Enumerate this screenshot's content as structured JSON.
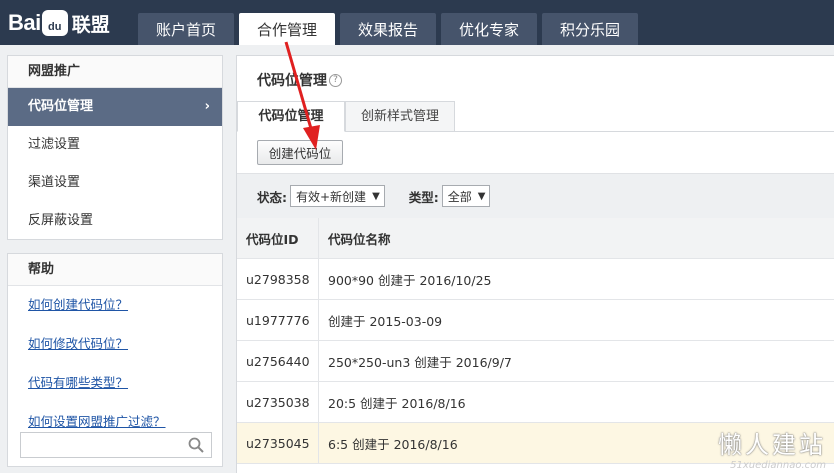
{
  "logo": {
    "bai": "Bai",
    "du": "du",
    "union": "联盟"
  },
  "nav": {
    "tabs": [
      {
        "label": "账户首页"
      },
      {
        "label": "合作管理"
      },
      {
        "label": "效果报告"
      },
      {
        "label": "优化专家"
      },
      {
        "label": "积分乐园"
      }
    ],
    "active": "合作管理"
  },
  "sidebar": {
    "title": "网盟推广",
    "items": [
      {
        "label": "代码位管理"
      },
      {
        "label": "过滤设置"
      },
      {
        "label": "渠道设置"
      },
      {
        "label": "反屏蔽设置"
      }
    ],
    "chevron": "›"
  },
  "help": {
    "title": "帮助",
    "links": [
      {
        "label": "如何创建代码位？"
      },
      {
        "label": "如何修改代码位？"
      },
      {
        "label": "代码有哪些类型？"
      },
      {
        "label": "如何设置网盟推广过滤？"
      }
    ],
    "search_value": ""
  },
  "main": {
    "title": "代码位管理",
    "help_mark": "?",
    "subtabs": [
      {
        "label": "代码位管理"
      },
      {
        "label": "创新样式管理"
      }
    ],
    "create_button": "创建代码位",
    "filters": {
      "status_label": "状态:",
      "status_value": "有效+新创建",
      "type_label": "类型:",
      "type_value": "全部",
      "caret": "▼"
    },
    "table": {
      "headers": {
        "id": "代码位ID",
        "name": "代码位名称"
      },
      "rows": [
        {
          "id": "u2798358",
          "name": "900*90 创建于 2016/10/25"
        },
        {
          "id": "u1977776",
          "name": "创建于 2015-03-09"
        },
        {
          "id": "u2756440",
          "name": "250*250-un3 创建于 2016/9/7"
        },
        {
          "id": "u2735038",
          "name": "20:5 创建于 2016/8/16"
        },
        {
          "id": "u2735045",
          "name": "6:5 创建于 2016/8/16"
        }
      ]
    }
  },
  "watermark": {
    "cn": "懒人建站",
    "en": "51xuediannao.com"
  },
  "colors": {
    "topbar": "#2c3a4f",
    "active_sidebar": "#5b6b85",
    "link": "#1f55a6",
    "annotation_arrow": "#e02020",
    "highlight_row": "#fdf7e3"
  }
}
